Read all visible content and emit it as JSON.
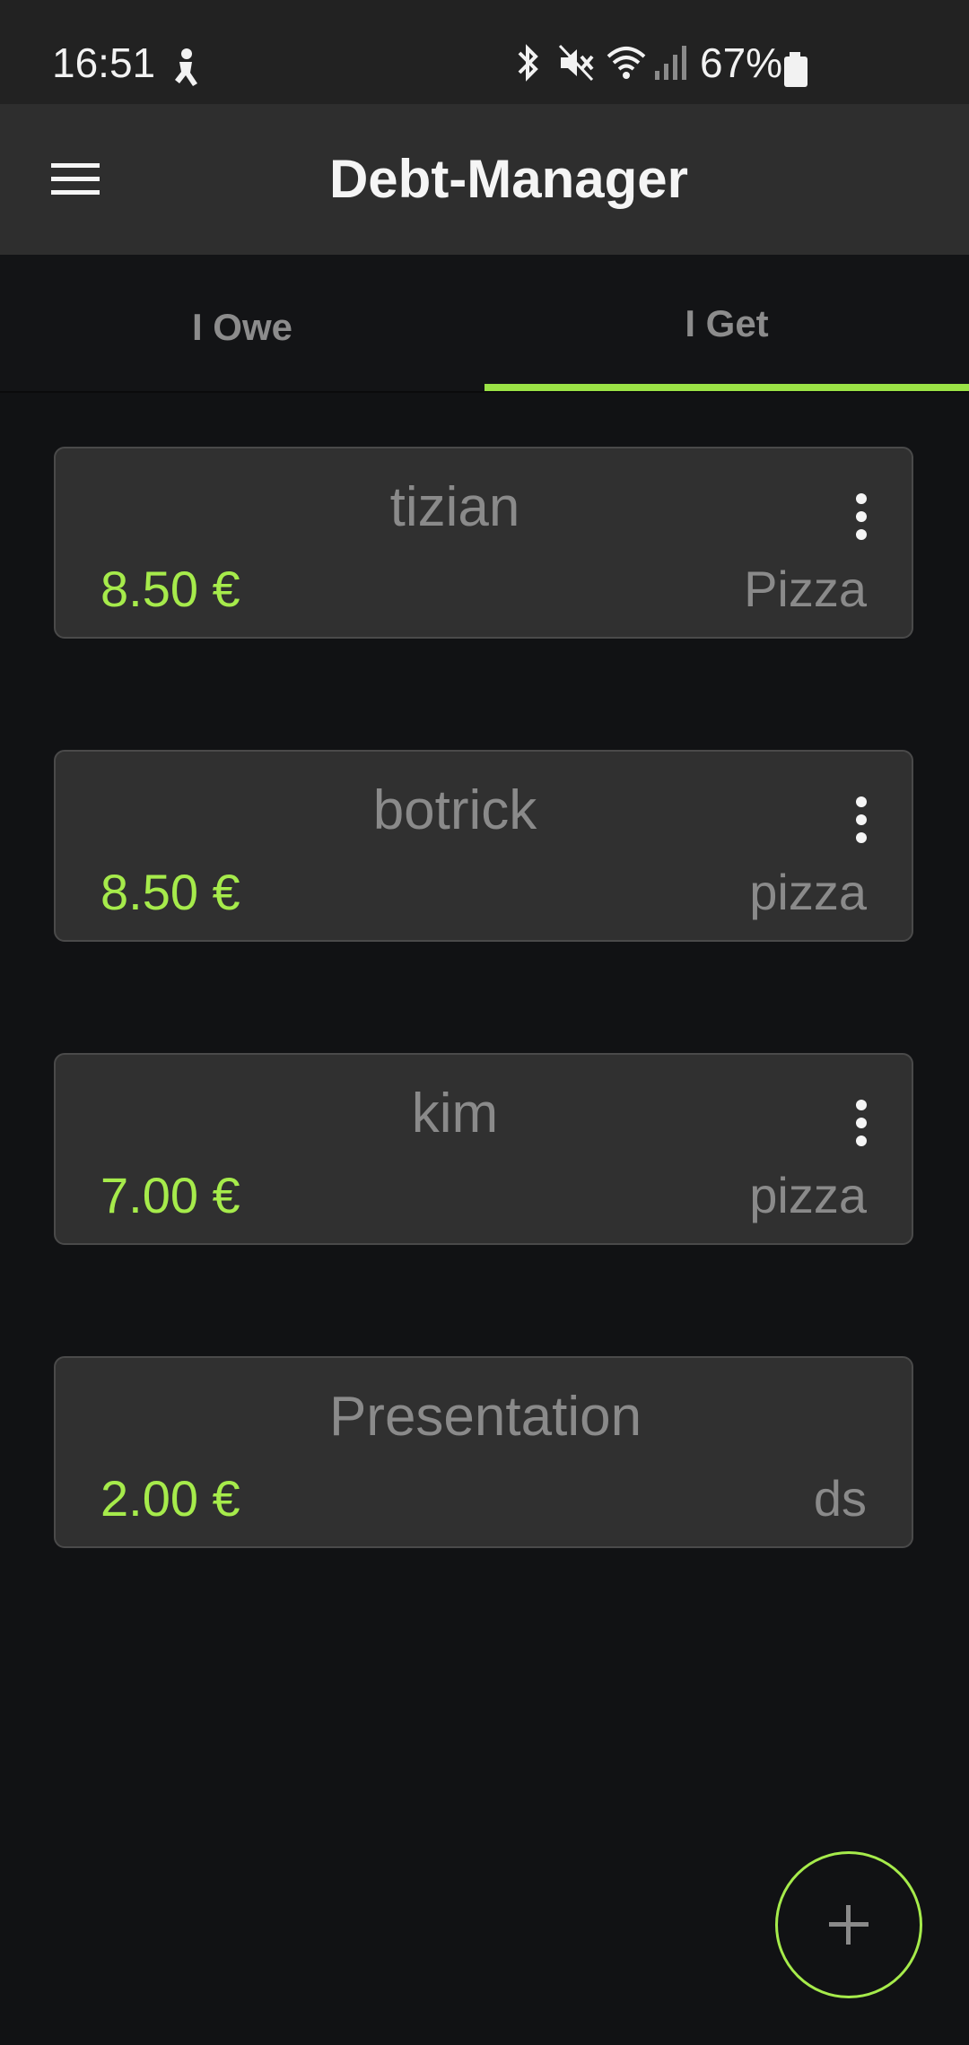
{
  "status_bar": {
    "time": "16:51",
    "battery_percent": "67%",
    "icons": [
      "accessibility-icon",
      "bluetooth-icon",
      "mute-icon",
      "wifi-icon",
      "signal-icon",
      "battery-icon"
    ]
  },
  "app_bar": {
    "title": "Debt-Manager",
    "menu_icon": "hamburger-menu-icon"
  },
  "tabs": [
    {
      "label": "I Owe",
      "selected": false
    },
    {
      "label": "I Get",
      "selected": true
    }
  ],
  "colors": {
    "accent": "#9be246",
    "amount": "#a6eb4b",
    "card_bg": "#303030",
    "background": "#111214",
    "app_bar": "#2e2e2e"
  },
  "debts": [
    {
      "name": "tizian",
      "amount": "8.50 €",
      "note": "Pizza",
      "has_menu": true
    },
    {
      "name": "botrick",
      "amount": "8.50 €",
      "note": "pizza",
      "has_menu": true
    },
    {
      "name": "kim",
      "amount": "7.00 €",
      "note": "pizza",
      "has_menu": true
    },
    {
      "name": "Presentation",
      "amount": "2.00 €",
      "note": "ds",
      "has_menu": false
    }
  ],
  "fab": {
    "icon": "plus-icon"
  }
}
